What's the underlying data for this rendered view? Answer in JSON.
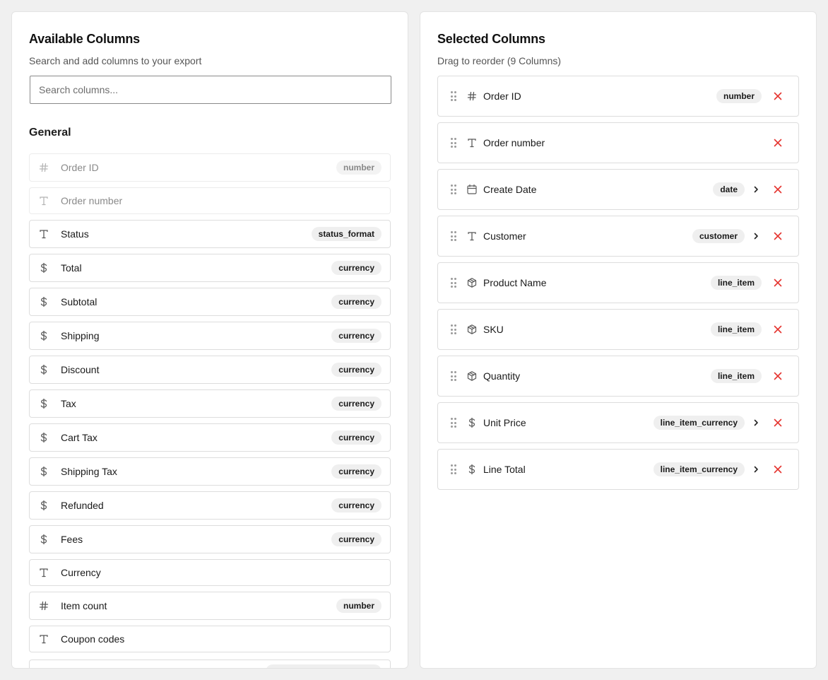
{
  "available": {
    "title": "Available Columns",
    "subtitle": "Search and add columns to your export",
    "search_placeholder": "Search columns...",
    "group_title": "General",
    "items": [
      {
        "label": "Order ID",
        "icon": "hash-icon",
        "badge": "number",
        "disabled": true
      },
      {
        "label": "Order number",
        "icon": "text-icon",
        "badge": "",
        "disabled": true
      },
      {
        "label": "Status",
        "icon": "text-icon",
        "badge": "status_format",
        "disabled": false
      },
      {
        "label": "Total",
        "icon": "dollar-icon",
        "badge": "currency",
        "disabled": false
      },
      {
        "label": "Subtotal",
        "icon": "dollar-icon",
        "badge": "currency",
        "disabled": false
      },
      {
        "label": "Shipping",
        "icon": "dollar-icon",
        "badge": "currency",
        "disabled": false
      },
      {
        "label": "Discount",
        "icon": "dollar-icon",
        "badge": "currency",
        "disabled": false
      },
      {
        "label": "Tax",
        "icon": "dollar-icon",
        "badge": "currency",
        "disabled": false
      },
      {
        "label": "Cart Tax",
        "icon": "dollar-icon",
        "badge": "currency",
        "disabled": false
      },
      {
        "label": "Shipping Tax",
        "icon": "dollar-icon",
        "badge": "currency",
        "disabled": false
      },
      {
        "label": "Refunded",
        "icon": "dollar-icon",
        "badge": "currency",
        "disabled": false
      },
      {
        "label": "Fees",
        "icon": "dollar-icon",
        "badge": "currency",
        "disabled": false
      },
      {
        "label": "Currency",
        "icon": "text-icon",
        "badge": "",
        "disabled": false
      },
      {
        "label": "Item count",
        "icon": "hash-icon",
        "badge": "number",
        "disabled": false
      },
      {
        "label": "Coupon codes",
        "icon": "text-icon",
        "badge": "",
        "disabled": false
      }
    ]
  },
  "selected": {
    "title": "Selected Columns",
    "subtitle": "Drag to reorder (9 Columns)",
    "items": [
      {
        "label": "Order ID",
        "icon": "hash-icon",
        "badge": "number",
        "expandable": false
      },
      {
        "label": "Order number",
        "icon": "text-icon",
        "badge": "",
        "expandable": false
      },
      {
        "label": "Create Date",
        "icon": "calendar-icon",
        "badge": "date",
        "expandable": true
      },
      {
        "label": "Customer",
        "icon": "text-icon",
        "badge": "customer",
        "expandable": true
      },
      {
        "label": "Product Name",
        "icon": "box-icon",
        "badge": "line_item",
        "expandable": false
      },
      {
        "label": "SKU",
        "icon": "box-icon",
        "badge": "line_item",
        "expandable": false
      },
      {
        "label": "Quantity",
        "icon": "box-icon",
        "badge": "line_item",
        "expandable": false
      },
      {
        "label": "Unit Price",
        "icon": "dollar-icon",
        "badge": "line_item_currency",
        "expandable": true
      },
      {
        "label": "Line Total",
        "icon": "dollar-icon",
        "badge": "line_item_currency",
        "expandable": true
      }
    ]
  },
  "colors": {
    "remove": "#e5342f",
    "badge_bg": "#efefef",
    "page_bg": "#f0f0f0"
  }
}
